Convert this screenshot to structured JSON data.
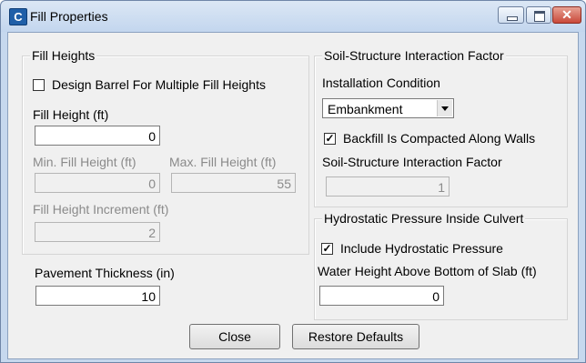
{
  "window": {
    "title": "Fill Properties",
    "icon": "app-c-icon",
    "close_glyph": "✕"
  },
  "fill_heights": {
    "group_title": "Fill Heights",
    "multiple_checkbox_label": "Design Barrel For Multiple Fill Heights",
    "multiple_checked": false,
    "fill_height_label": "Fill Height (ft)",
    "fill_height_value": "0",
    "min_label": "Min. Fill Height (ft)",
    "min_value": "0",
    "max_label": "Max. Fill Height (ft)",
    "max_value": "55",
    "increment_label": "Fill Height Increment (ft)",
    "increment_value": "2"
  },
  "pavement": {
    "label": "Pavement Thickness (in)",
    "value": "10"
  },
  "soil_structure": {
    "group_title": "Soil-Structure Interaction Factor",
    "installation_label": "Installation Condition",
    "installation_value": "Embankment",
    "backfill_checkbox_label": "Backfill Is Compacted Along Walls",
    "backfill_checked": true,
    "factor_label": "Soil-Structure Interaction Factor",
    "factor_value": "1"
  },
  "hydrostatic": {
    "group_title": "Hydrostatic Pressure Inside Culvert",
    "include_checkbox_label": "Include Hydrostatic Pressure",
    "include_checked": true,
    "water_height_label": "Water Height Above Bottom of Slab (ft)",
    "water_height_value": "0"
  },
  "buttons": {
    "close_label": "Close",
    "restore_label": "Restore Defaults"
  },
  "checkmark_glyph": "✓"
}
